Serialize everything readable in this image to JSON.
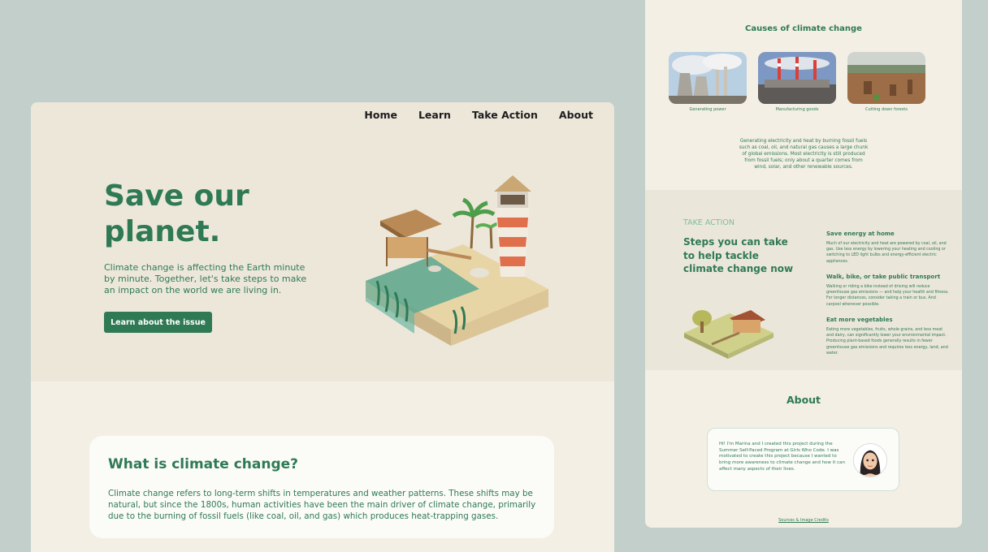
{
  "nav": {
    "items": [
      "Home",
      "Learn",
      "Take Action",
      "About"
    ]
  },
  "hero": {
    "title": "Save our planet.",
    "text": "Climate change is affecting the Earth minute by minute. Together, let's take steps to make an impact on the world we are living in.",
    "button": "Learn about the issue"
  },
  "what_is": {
    "title": "What is climate change?",
    "text": "Climate change refers to long-term shifts in temperatures and weather patterns. These shifts may be natural, but since the 1800s, human activities have been the main driver of climate change, primarily due to the burning of fossil fuels (like coal, oil, and gas) which produces heat-trapping gases."
  },
  "causes": {
    "title": "Causes of climate change",
    "items": [
      {
        "label": "Generating power",
        "image": "power-plant-photo"
      },
      {
        "label": "Manufacturing goods",
        "image": "factory-photo"
      },
      {
        "label": "Cutting down forests",
        "image": "deforestation-photo"
      }
    ],
    "text": "Generating electricity and heat by burning fossil fuels such as coal, oil, and natural gas causes a large chunk of global emissions. Most electricity is still produced from fossil fuels; only about a quarter comes from wind, solar, and other renewable sources."
  },
  "take_action": {
    "kicker": "TAKE ACTION",
    "title": "Steps you can take to help tackle climate change now",
    "tips": [
      {
        "title": "Save energy at home",
        "text": "Much of our electricity and heat are powered by coal, oil, and gas. Use less energy by lowering your heating and cooling or switching to LED light bulbs and energy-efficient electric appliances."
      },
      {
        "title": "Walk, bike, or take public transport",
        "text": "Walking or riding a bike instead of driving will reduce greenhouse gas emissions — and help your health and fitness. For longer distances, consider taking a train or bus. And carpool whenever possible."
      },
      {
        "title": "Eat more vegetables",
        "text": "Eating more vegetables, fruits, whole grains, and less meat and dairy, can significantly lower your environmental impact. Producing plant-based foods generally results in fewer greenhouse gas emissions and requires less energy, land, and water."
      }
    ]
  },
  "about": {
    "title": "About",
    "text": "Hi! I'm Marina and I created this project during the Summer Self-Paced Program at Girls Who Code. I was motivated to create this project because I wanted to bring more awareness to climate change and how it can affect many aspects of their lives."
  },
  "footer": {
    "credits": "Sources & Image Credits"
  },
  "colors": {
    "brand_green": "#2f7a55",
    "light_green": "#7fbf96",
    "background": "#c2cfca",
    "panel": "#f3efe4"
  }
}
